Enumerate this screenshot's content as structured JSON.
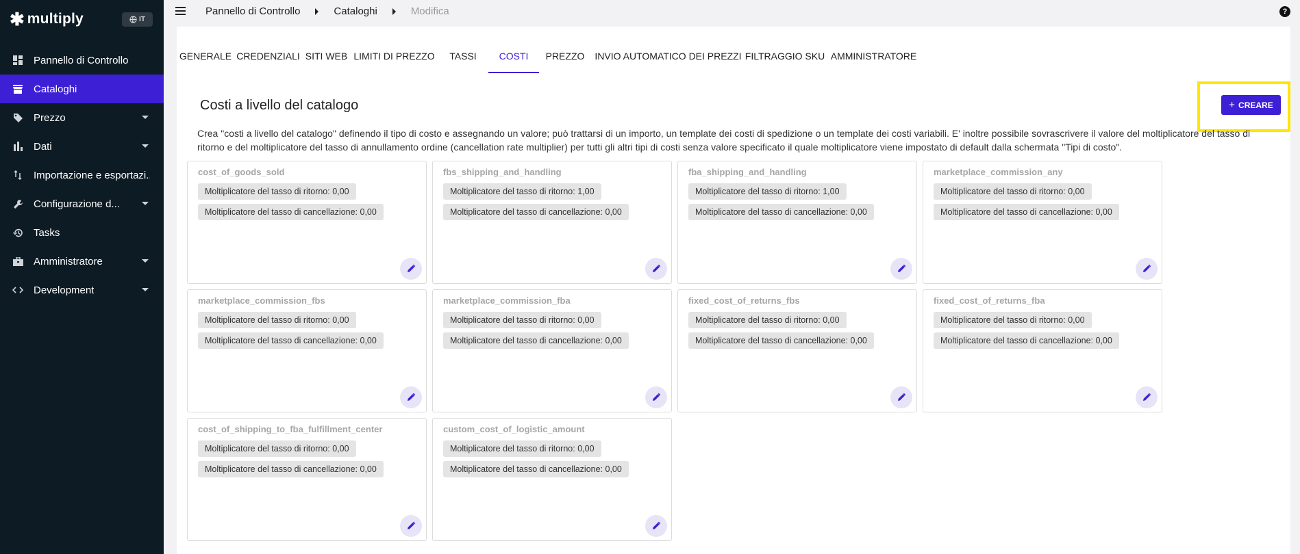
{
  "sidebar": {
    "brand": "multiply",
    "language": "IT",
    "items": [
      {
        "label": "Pannello di Controllo",
        "icon": "dashboard-icon",
        "active": false,
        "expandable": false
      },
      {
        "label": "Cataloghi",
        "icon": "store-icon",
        "active": true,
        "expandable": false
      },
      {
        "label": "Prezzo",
        "icon": "tag-icon",
        "active": false,
        "expandable": true
      },
      {
        "label": "Dati",
        "icon": "bar-chart-icon",
        "active": false,
        "expandable": true
      },
      {
        "label": "Importazione e esportazi...",
        "icon": "import-export-icon",
        "active": false,
        "expandable": false
      },
      {
        "label": "Configurazione d...",
        "icon": "wrench-icon",
        "active": false,
        "expandable": true
      },
      {
        "label": "Tasks",
        "icon": "history-icon",
        "active": false,
        "expandable": false
      },
      {
        "label": "Amministratore",
        "icon": "toolbox-icon",
        "active": false,
        "expandable": true
      },
      {
        "label": "Development",
        "icon": "code-icon",
        "active": false,
        "expandable": true
      }
    ]
  },
  "breadcrumb": [
    "Pannello di Controllo",
    "Cataloghi",
    "Modifica"
  ],
  "tabs": [
    {
      "label": "GENERALE",
      "active": false
    },
    {
      "label": "CREDENZIALI",
      "active": false
    },
    {
      "label": "SITI WEB",
      "active": false
    },
    {
      "label": "LIMITI DI PREZZO",
      "active": false
    },
    {
      "label": "TASSI",
      "active": false
    },
    {
      "label": "COSTI",
      "active": true
    },
    {
      "label": "PREZZO",
      "active": false
    },
    {
      "label": "INVIO AUTOMATICO DEI PREZZI",
      "active": false
    },
    {
      "label": "FILTRAGGIO SKU",
      "active": false
    },
    {
      "label": "AMMINISTRATORE",
      "active": false
    }
  ],
  "section": {
    "title": "Costi a livello del catalogo",
    "create_label": "CREARE",
    "description": "Crea \"costi a livello del catalogo\" definendo il tipo di costo e assegnando un valore; può trattarsi di un importo, un template dei costi di spedizione o un template dei costi variabili. E' inoltre possibile sovrascrivere il valore del moltiplicatore del tasso di ritorno e del moltiplicatore del tasso di annullamento ordine (cancellation rate multiplier) per tutti gli altri tipi di costi senza valore specificato il quale moltiplicatore viene impostato di default dalla schermata \"Tipi di costo\"."
  },
  "cards": [
    {
      "title": "cost_of_goods_sold",
      "return_rate": "Moltiplicatore del tasso di ritorno: 0,00",
      "cancel_rate": "Moltiplicatore del tasso di cancellazione: 0,00"
    },
    {
      "title": "fbs_shipping_and_handling",
      "return_rate": "Moltiplicatore del tasso di ritorno: 1,00",
      "cancel_rate": "Moltiplicatore del tasso di cancellazione: 0,00"
    },
    {
      "title": "fba_shipping_and_handling",
      "return_rate": "Moltiplicatore del tasso di ritorno: 1,00",
      "cancel_rate": "Moltiplicatore del tasso di cancellazione: 0,00"
    },
    {
      "title": "marketplace_commission_any",
      "return_rate": "Moltiplicatore del tasso di ritorno: 0,00",
      "cancel_rate": "Moltiplicatore del tasso di cancellazione: 0,00"
    },
    {
      "title": "marketplace_commission_fbs",
      "return_rate": "Moltiplicatore del tasso di ritorno: 0,00",
      "cancel_rate": "Moltiplicatore del tasso di cancellazione: 0,00"
    },
    {
      "title": "marketplace_commission_fba",
      "return_rate": "Moltiplicatore del tasso di ritorno: 0,00",
      "cancel_rate": "Moltiplicatore del tasso di cancellazione: 0,00"
    },
    {
      "title": "fixed_cost_of_returns_fbs",
      "return_rate": "Moltiplicatore del tasso di ritorno: 0,00",
      "cancel_rate": "Moltiplicatore del tasso di cancellazione: 0,00"
    },
    {
      "title": "fixed_cost_of_returns_fba",
      "return_rate": "Moltiplicatore del tasso di ritorno: 0,00",
      "cancel_rate": "Moltiplicatore del tasso di cancellazione: 0,00"
    },
    {
      "title": "cost_of_shipping_to_fba_fulfillment_center",
      "return_rate": "Moltiplicatore del tasso di ritorno: 0,00",
      "cancel_rate": "Moltiplicatore del tasso di cancellazione: 0,00"
    },
    {
      "title": "custom_cost_of_logistic_amount",
      "return_rate": "Moltiplicatore del tasso di ritorno: 0,00",
      "cancel_rate": "Moltiplicatore del tasso di cancellazione: 0,00"
    }
  ],
  "colors": {
    "accent": "#3d1fd6",
    "sidebar_bg": "#0d1b24",
    "highlight": "#ffe600",
    "chip_bg": "#e4e4e4"
  }
}
